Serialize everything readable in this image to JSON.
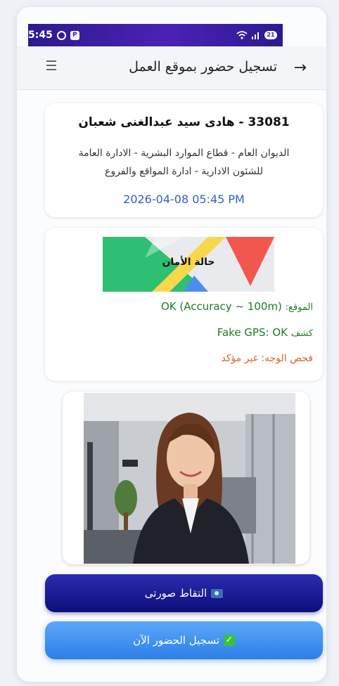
{
  "statusbar": {
    "time": "5:45",
    "battery": "21"
  },
  "header": {
    "title": "تسجيل حضور بموقع العمل"
  },
  "employee": {
    "name": "33081 - هادى سيد عبدالغنى شعبان",
    "department_line1": "الديوان العام - قطاع الموارد البشرية - الادارة العامة",
    "department_line2": "للشئون الادارية  - ادارة المواقع والفروع",
    "datetime": "2026-04-08 05:45 PM"
  },
  "safety": {
    "map_label": "حالة الأمان",
    "location_label": "الموقع:",
    "location_value": "OK (Accuracy ~ 100m)",
    "fake_gps_label": "كشف",
    "fake_gps_value": "Fake GPS: OK",
    "face_check": "فحص الوجه: غير مؤكد"
  },
  "buttons": {
    "capture": "التقاط صورتى",
    "checkin": "تسجيل الحضور الآن"
  },
  "colors": {
    "primary_dark": "#0b0e7a",
    "primary_light": "#2d7ee8",
    "ok_green": "#1e7b2a",
    "warning_orange": "#d8652a",
    "time_blue": "#2f5fc8"
  }
}
